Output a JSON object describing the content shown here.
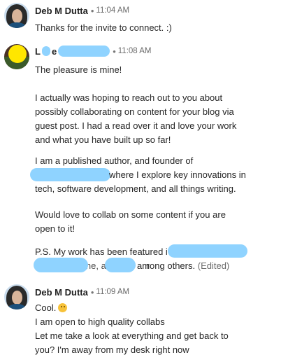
{
  "messages": [
    {
      "sender": "Deb M Dutta",
      "separator": "•",
      "time": "11:04 AM",
      "lines": [
        "Thanks for the invite to connect. :)"
      ]
    },
    {
      "sender_visible_start": "L",
      "sender_visible_end": "e",
      "separator": "•",
      "time": "11:08 AM",
      "lines": [
        "The pleasure is mine!",
        "",
        "I actually was hoping to reach out to you about",
        "possibly collaborating on content for your blog via",
        "guest post. I had a read over it and love your work",
        "and what you have built up so far!",
        "",
        "I am a published author, and founder of",
        "where I explore key innovations in",
        "tech, software development, and all things writing.",
        "",
        "Would love to collab on some content if you are",
        "open to it!",
        "",
        "P.S. My work has been featured i",
        "among others.",
        "(Edited)"
      ],
      "partially_visible": [
        "ine, and T",
        "r"
      ]
    },
    {
      "sender": "Deb M Dutta",
      "separator": "•",
      "time": "11:09 AM",
      "lines": [
        "Cool.",
        "I am open to high quality collabs",
        "Let me take a look at everything and get back to",
        "you? I'm away from my desk right now"
      ],
      "emoji": "slightly-smiling-face-icon"
    }
  ],
  "colors": {
    "redaction": "#8fd3ff",
    "text": "#262626",
    "muted": "#6b6b6b"
  }
}
